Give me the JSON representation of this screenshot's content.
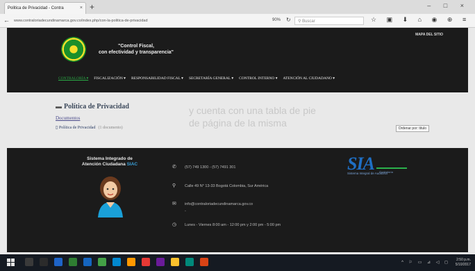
{
  "browser": {
    "tab_title": "Politica de Privacidad - Contra",
    "tab_close": "×",
    "new_tab": "+",
    "url": "www.contraloriadecundinamarca.gov.co/index.php/con-la-politica-de-privacidad",
    "zoom": "90%",
    "search_placeholder": "Buscar"
  },
  "site": {
    "slogan_line1": "\"Control Fiscal,",
    "slogan_line2": "con efectividad y transparencia\"",
    "sitemap_link": "MAPA DEL SITIO",
    "menu": [
      {
        "label": "CONTRALORÍA ▾",
        "active": true
      },
      {
        "label": "FISCALIZACIÓN ▾"
      },
      {
        "label": "RESPONSABILIDAD FISCAL ▾"
      },
      {
        "label": "SECRETARÍA GENERAL ▾"
      },
      {
        "label": "CONTROL INTERNO ▾"
      },
      {
        "label": "ATENCIÓN AL CIUDADANO ▾"
      }
    ]
  },
  "main": {
    "page_title": "Política de Privacidad",
    "docs_heading": "Documentos",
    "document": {
      "name": "Política de Privacidad",
      "meta": "(1 documento)"
    },
    "sort_label": "Ordenar por: titulo"
  },
  "background_text": {
    "line1": "y cuenta con una tabla de pie",
    "line2": "de página de la misma"
  },
  "footer": {
    "siac_line1": "Sistema Integrado de",
    "siac_line2": "Atención Ciudadana",
    "siac_accent": "SIAC",
    "phone": "(57) 749 1300 - (57) 7491 301",
    "address": "Calle 49 N° 13-33 Bogotá Colombia, Sur América",
    "email1": "info@contraloriadecundinamarca.gov.co",
    "email2": "-",
    "hours": "Lunes - Viernes 8:00 am - 12:00 pm y 2:00 pm - 5:00 pm",
    "sia_logo": "SIA",
    "sia_tagline": "Sistema Integral de Auditoría",
    "sia_small": "Contraloría"
  },
  "taskbar": {
    "tray": "^ ⚐ ▭ ⊿ ◁ ◻",
    "time": "2:50 p.m.",
    "date": "5/10/2017"
  },
  "colors": {
    "header_bg": "#1b1b1b",
    "accent_green": "#2aa845",
    "sia_blue": "#1f6fc4"
  }
}
